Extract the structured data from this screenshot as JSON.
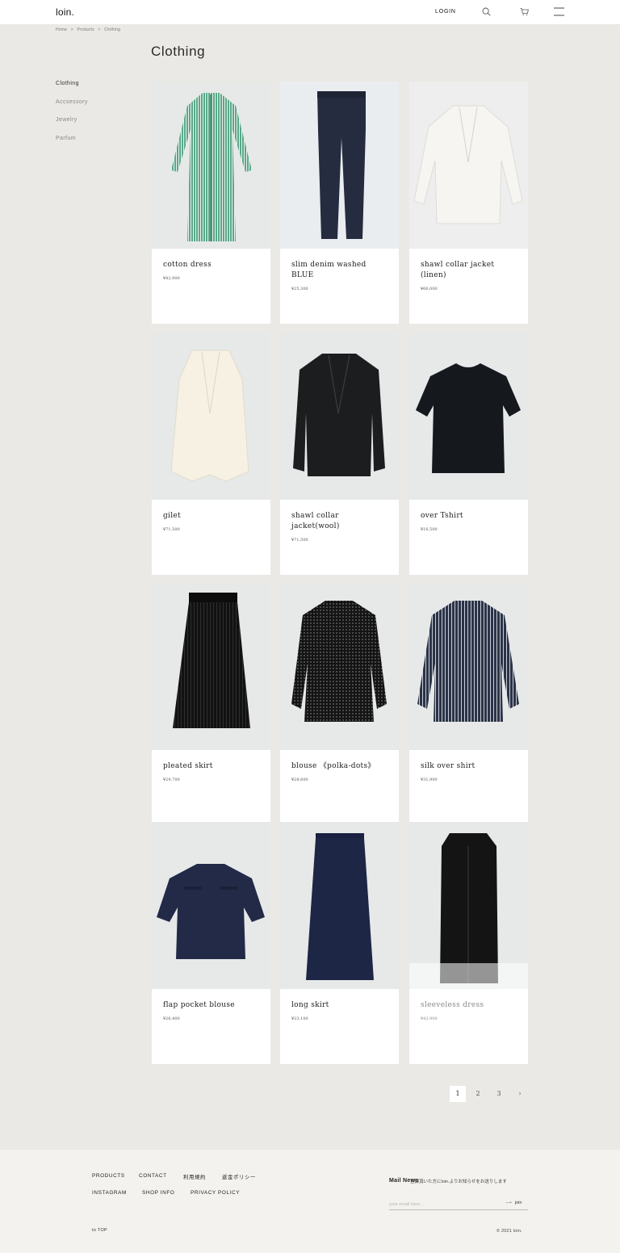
{
  "header": {
    "logo": "loin.",
    "login": "LOGIN"
  },
  "breadcrumb": [
    "Home",
    ">",
    "Products",
    ">",
    "Clothing"
  ],
  "page_title": "Clothing",
  "sidebar": {
    "items": [
      {
        "label": "Clothing",
        "active": true
      },
      {
        "label": "Accsessory",
        "active": false
      },
      {
        "label": "Jewelry",
        "active": false
      },
      {
        "label": "Parfum",
        "active": false
      }
    ]
  },
  "products": [
    {
      "name": "cotton dress",
      "price": "¥42,900"
    },
    {
      "name": "slim denim washed BLUE",
      "price": "¥25,300"
    },
    {
      "name": "shawl collar jacket (linen)",
      "price": "¥66,000"
    },
    {
      "name": "gilet",
      "price": "¥71,500"
    },
    {
      "name": "shawl collar jacket(wool)",
      "price": "¥71,500"
    },
    {
      "name": "over Tshirt",
      "price": "¥16,500"
    },
    {
      "name": "pleated skirt",
      "price": "¥29,700"
    },
    {
      "name": "blouse 《polka-dots》",
      "price": "¥28,600"
    },
    {
      "name": "silk over shirt",
      "price": "¥31,900"
    },
    {
      "name": "flap pocket blouse",
      "price": "¥26,400"
    },
    {
      "name": "long skirt",
      "price": "¥23,100"
    },
    {
      "name": "sleeveless dress",
      "price": "¥42,900"
    }
  ],
  "pagination": {
    "pages": [
      "1",
      "2",
      "3"
    ],
    "next": "›",
    "current": "1"
  },
  "footer": {
    "links_row1": [
      "PRODUCTS",
      "CONTACT",
      "利用規約",
      "返金ポリシー"
    ],
    "links_row2": [
      "INSTAGRAM",
      "SHOP INFO",
      "PRIVACY POLICY"
    ],
    "mail_title": "Mail News",
    "mail_desc": "登録頂いた方にloin.よりお知らせをお送りします",
    "email_placeholder": "your email here...",
    "join": "join",
    "to_top": "to TOP",
    "copyright": "© 2021 loin."
  },
  "icons": {
    "search": "search-icon",
    "cart": "cart-icon",
    "menu": "menu-icon",
    "join_arrow": "arrow-right-icon"
  }
}
